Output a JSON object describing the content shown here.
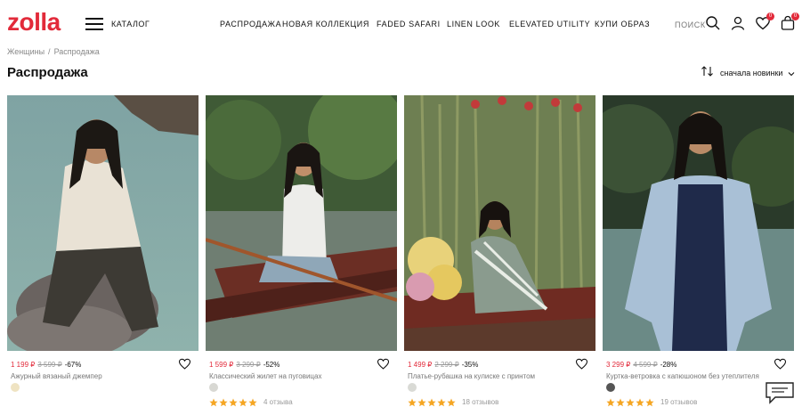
{
  "header": {
    "logo": "zolla",
    "catalog_label": "КАТАЛОГ",
    "nav": [
      "РАСПРОДАЖА",
      "НОВАЯ КОЛЛЕКЦИЯ",
      "FADED SAFARI",
      "LINEN LOOK",
      "ELEVATED UTILITY",
      "КУПИ ОБРАЗ"
    ],
    "search_label": "ПОИСК",
    "favorites_count": "0",
    "cart_count": "0"
  },
  "breadcrumb": [
    "Женщины",
    "Распродажа"
  ],
  "page_title": "Распродажа",
  "sort_label": "сначала новинки",
  "colors": {
    "brand": "#e22a3a",
    "star": "#f5a623"
  },
  "products": [
    {
      "price": "1 199 ₽",
      "old_price": "3 599 ₽",
      "discount": "-67%",
      "name": "Ажурный вязаный джемпер",
      "swatch": "#efe3c2",
      "reviews": ""
    },
    {
      "price": "1 599 ₽",
      "old_price": "3 299 ₽",
      "discount": "-52%",
      "name": "Классический жилет на пуговицах",
      "swatch": "#d8d8d3",
      "reviews": "4 отзыва"
    },
    {
      "price": "1 499 ₽",
      "old_price": "2 299 ₽",
      "discount": "-35%",
      "name": "Платье-рубашка на кулиске с принтом",
      "swatch": "#d9dad5",
      "reviews": "18 отзывов"
    },
    {
      "price": "3 299 ₽",
      "old_price": "4 599 ₽",
      "discount": "-28%",
      "name": "Куртка-ветровка с капюшоном без утеплителя",
      "swatch": "#555555",
      "reviews": "19 отзывов"
    }
  ]
}
